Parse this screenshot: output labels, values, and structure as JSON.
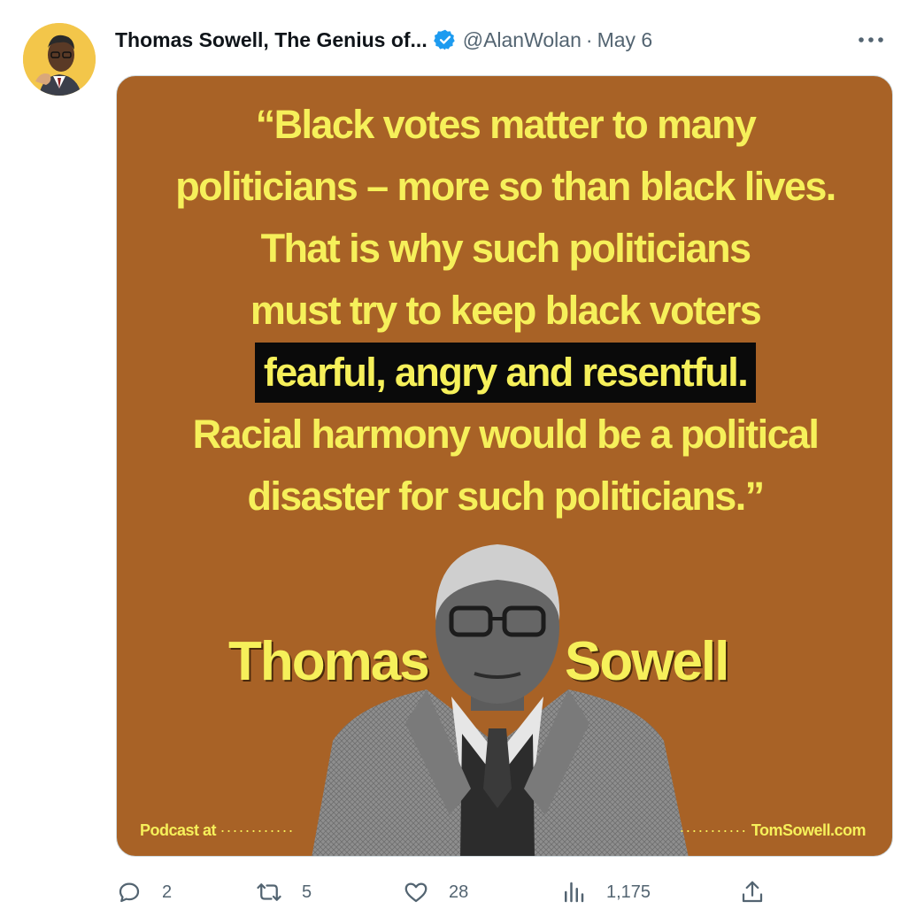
{
  "tweet": {
    "author": {
      "display_name": "Thomas Sowell, The Genius of...",
      "handle": "@AlanWolan",
      "verified": true,
      "avatar_icon": "avatar-portrait"
    },
    "separator": "·",
    "date": "May 6",
    "more_icon": "more-icon"
  },
  "media": {
    "background_color": "#a86226",
    "text_color": "#f6f05a",
    "highlight_color": "#0a0a0a",
    "quote_lines": [
      "“Black votes matter to many",
      "politicians – more so than black lives.",
      "That is why such politicians",
      "must try to keep black voters",
      "fearful, angry and resentful.",
      "Racial harmony would be a political",
      "disaster for such politicians.”"
    ],
    "name_first": "Thomas",
    "name_last": "Sowell",
    "footer_left": "Podcast at",
    "footer_left_dots": "············",
    "footer_right_dots": "···········",
    "footer_right": "TomSowell.com"
  },
  "actions": {
    "reply": {
      "icon": "reply-icon",
      "count": "2"
    },
    "retweet": {
      "icon": "retweet-icon",
      "count": "5"
    },
    "like": {
      "icon": "like-icon",
      "count": "28"
    },
    "views": {
      "icon": "views-icon",
      "count": "1,175"
    },
    "share": {
      "icon": "share-icon"
    }
  }
}
